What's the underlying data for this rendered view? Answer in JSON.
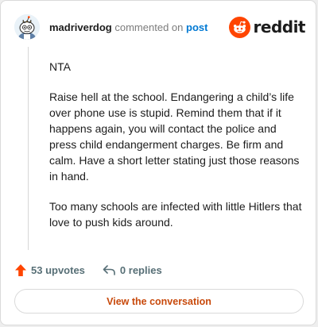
{
  "header": {
    "username": "madriverdog",
    "action_text": "commented on",
    "post_link": "post",
    "brand": "reddit"
  },
  "comment": {
    "paragraphs": [
      "NTA",
      "Raise hell at the school. Endangering a child’s life over phone use is stupid. Remind them that if it happens again, you will contact the police and press child endangerment charges. Be firm and calm. Have a short letter stating just those reasons in hand.",
      "Too many schools are infected with little Hitlers that love to push kids around."
    ]
  },
  "actions": {
    "upvotes": "53 upvotes",
    "replies": "0 replies"
  },
  "cta": {
    "label": "View the conversation"
  },
  "colors": {
    "brand_orange": "#ff4500",
    "link_blue": "#0079d3",
    "cta_text": "#c8490b"
  },
  "icons": [
    "avatar-snoo",
    "reddit-logo-icon",
    "upvote-arrow-icon",
    "reply-arrow-icon"
  ]
}
